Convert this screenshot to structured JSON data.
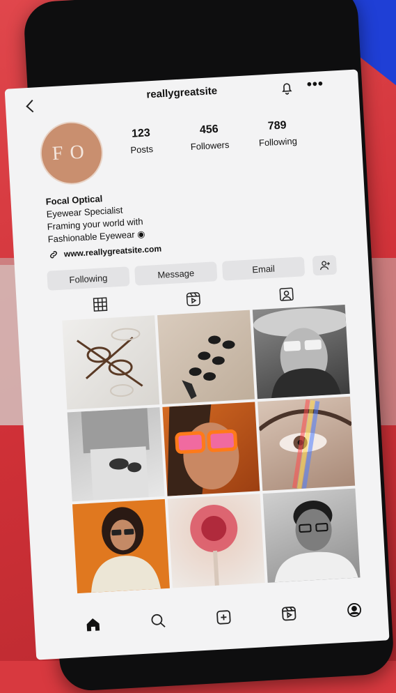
{
  "profile": {
    "username": "reallygreatsite",
    "avatar_initials": "FO",
    "display_name": "Focal Optical",
    "bio_lines": [
      "Eyewear Specialist",
      "Framing your world with",
      "Fashionable Eyewear"
    ],
    "website": "www.reallygreatsite.com"
  },
  "stats": [
    {
      "value": "123",
      "label": "Posts"
    },
    {
      "value": "456",
      "label": "Followers"
    },
    {
      "value": "789",
      "label": "Following"
    }
  ],
  "actions": {
    "following": "Following",
    "message": "Message",
    "email": "Email"
  },
  "tabs": [
    "grid-icon",
    "reels-icon",
    "tagged-icon"
  ],
  "bottom_nav": [
    "home-icon",
    "search-icon",
    "create-icon",
    "reels-icon",
    "profile-icon"
  ],
  "colors": {
    "background": "#d8393f",
    "accent_blue": "#1f3fd6",
    "avatar": "#c98f6f",
    "screen": "#f3f3f4"
  }
}
